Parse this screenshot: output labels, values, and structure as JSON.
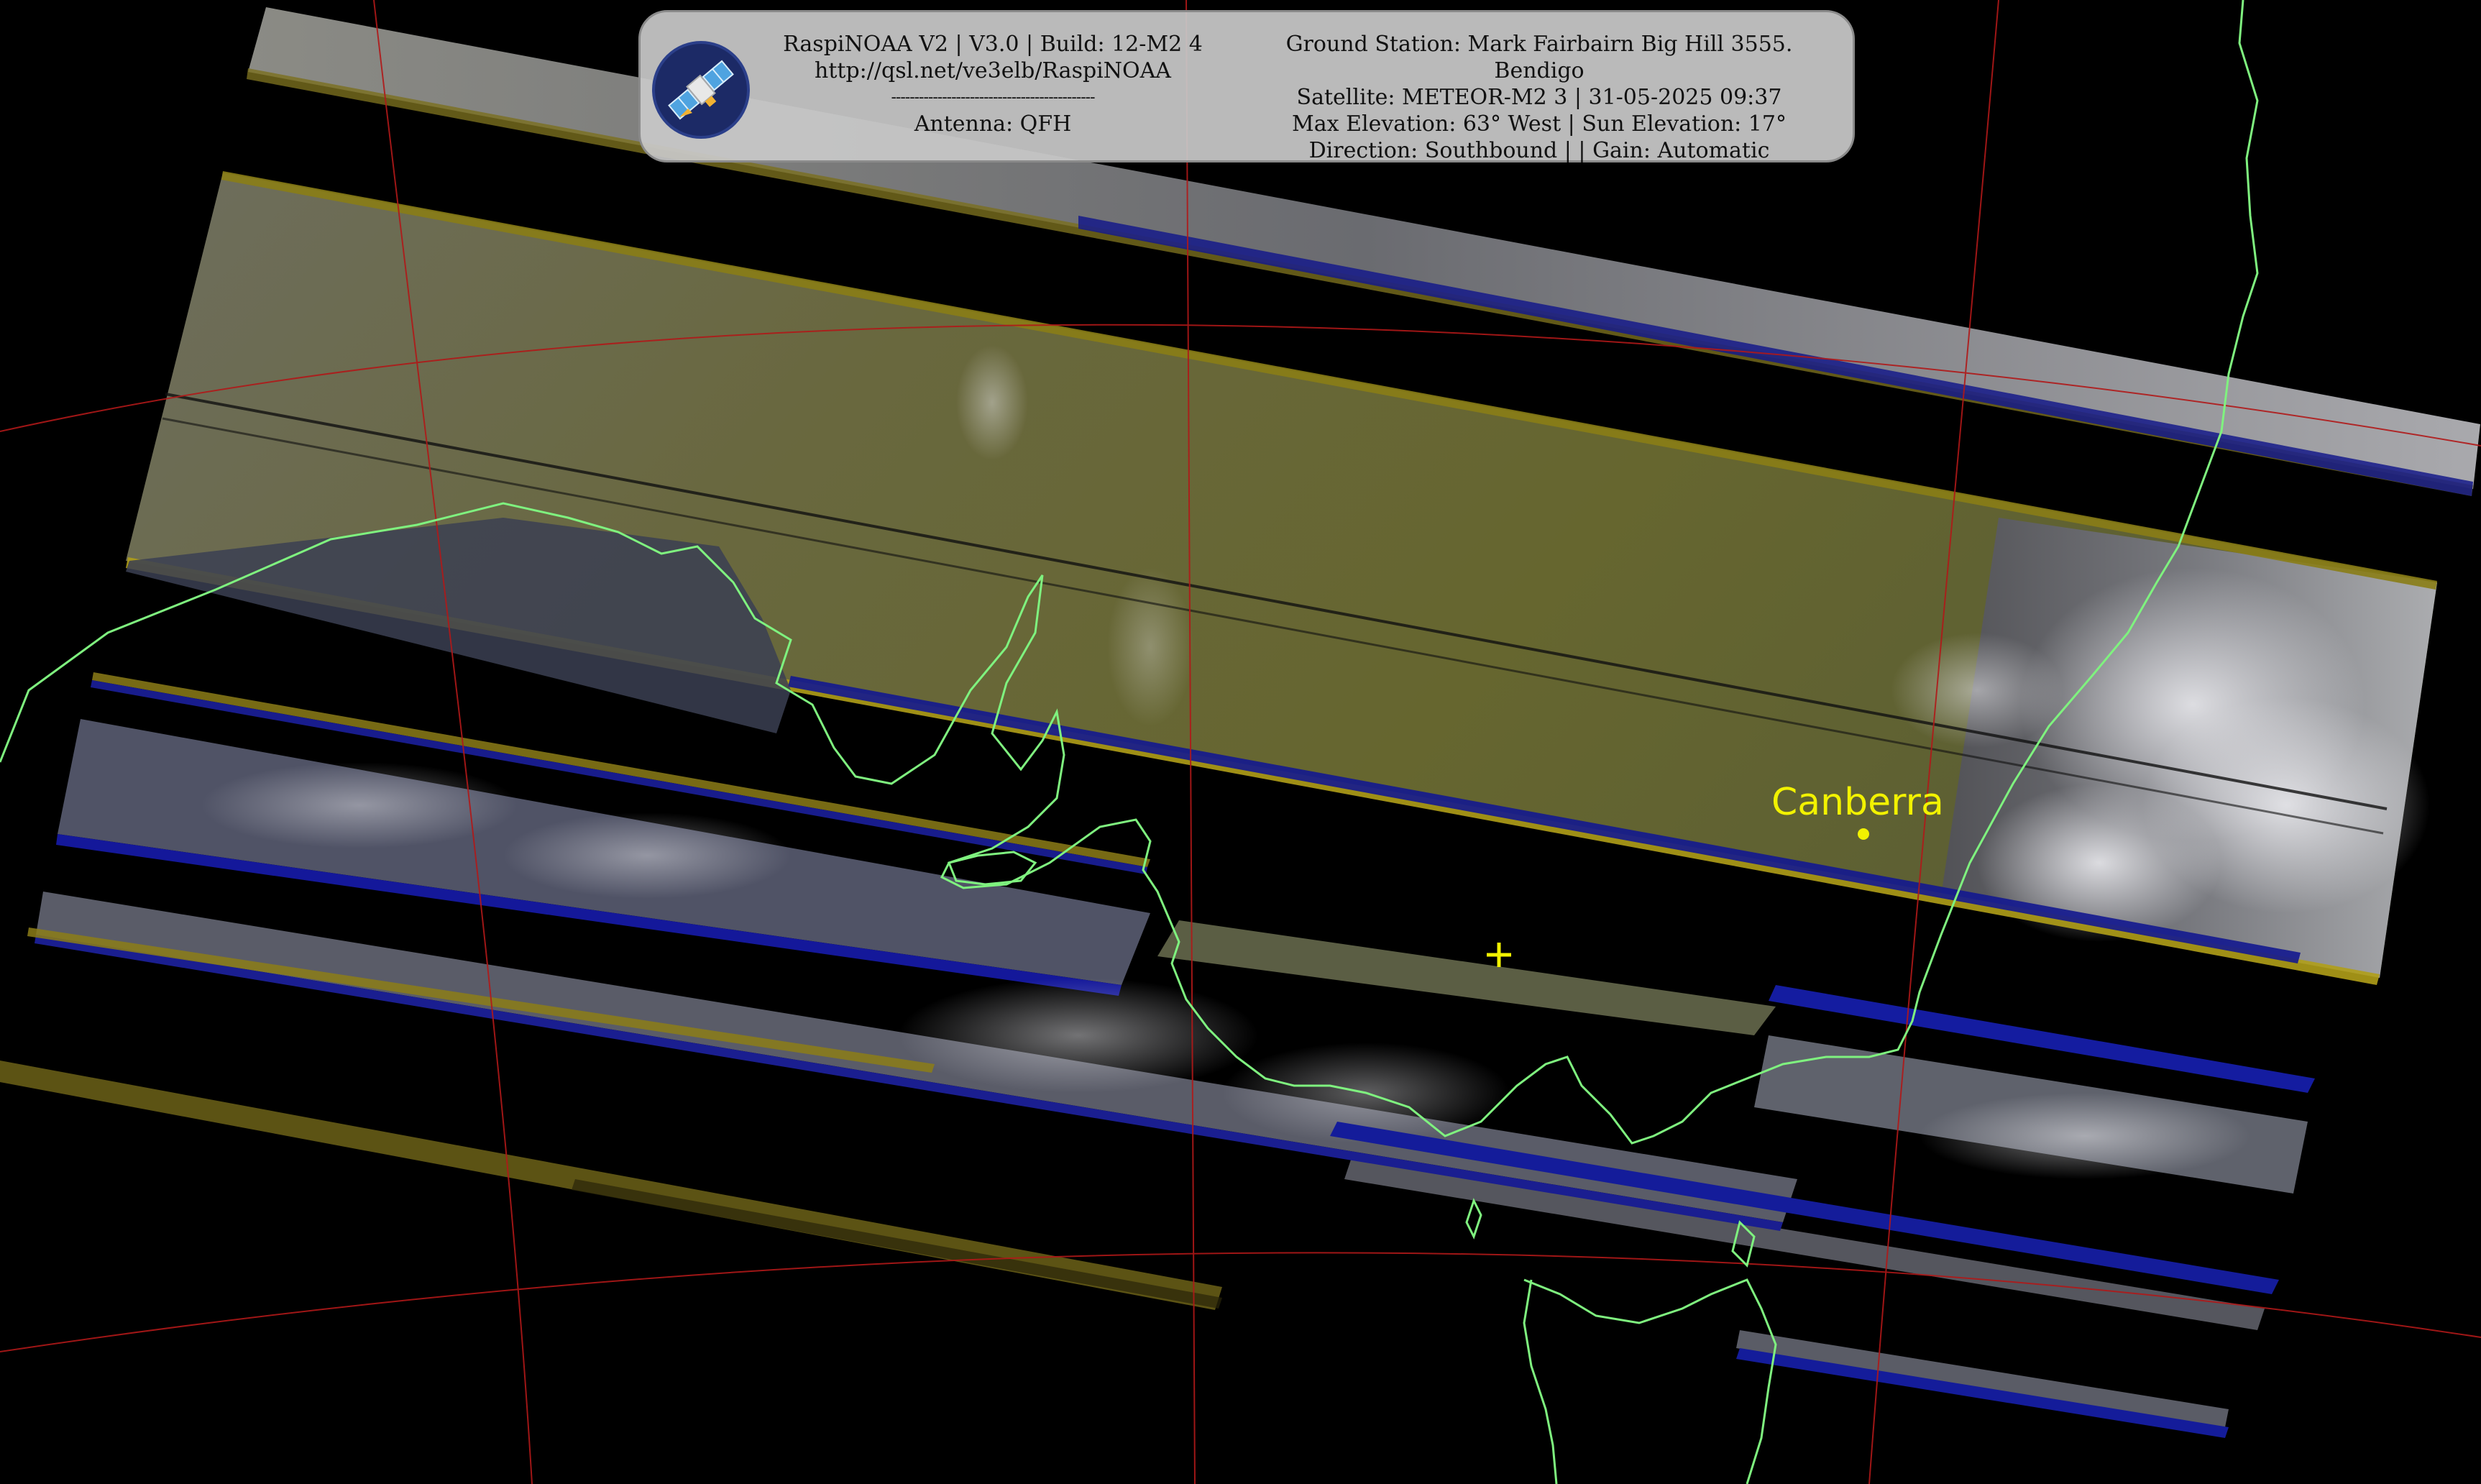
{
  "header": {
    "left_lines": [
      "RaspiNOAA V2 | V3.0 | Build: 12-M2 4",
      "http://qsl.net/ve3elb/RaspiNOAA",
      "--------------------------------------------",
      "Antenna: QFH"
    ],
    "right_lines": [
      "Ground Station: Mark Fairbairn Big Hill 3555.",
      "Bendigo",
      "Satellite: METEOR-M2 3 | 31-05-2025 09:37",
      "Max Elevation: 63° West | Sun Elevation: 17°",
      "Direction: Southbound | | Gain: Automatic"
    ]
  },
  "map": {
    "city_label": "Canberra",
    "city_marker_color": "#f2f200",
    "coastline_color": "#7ff27f",
    "grid_color": "#b01818",
    "station_marker_color": "#f2f200"
  },
  "icons": {
    "logo": "satellite-logo-icon",
    "station": "crosshair-icon",
    "city": "city-dot-icon"
  }
}
